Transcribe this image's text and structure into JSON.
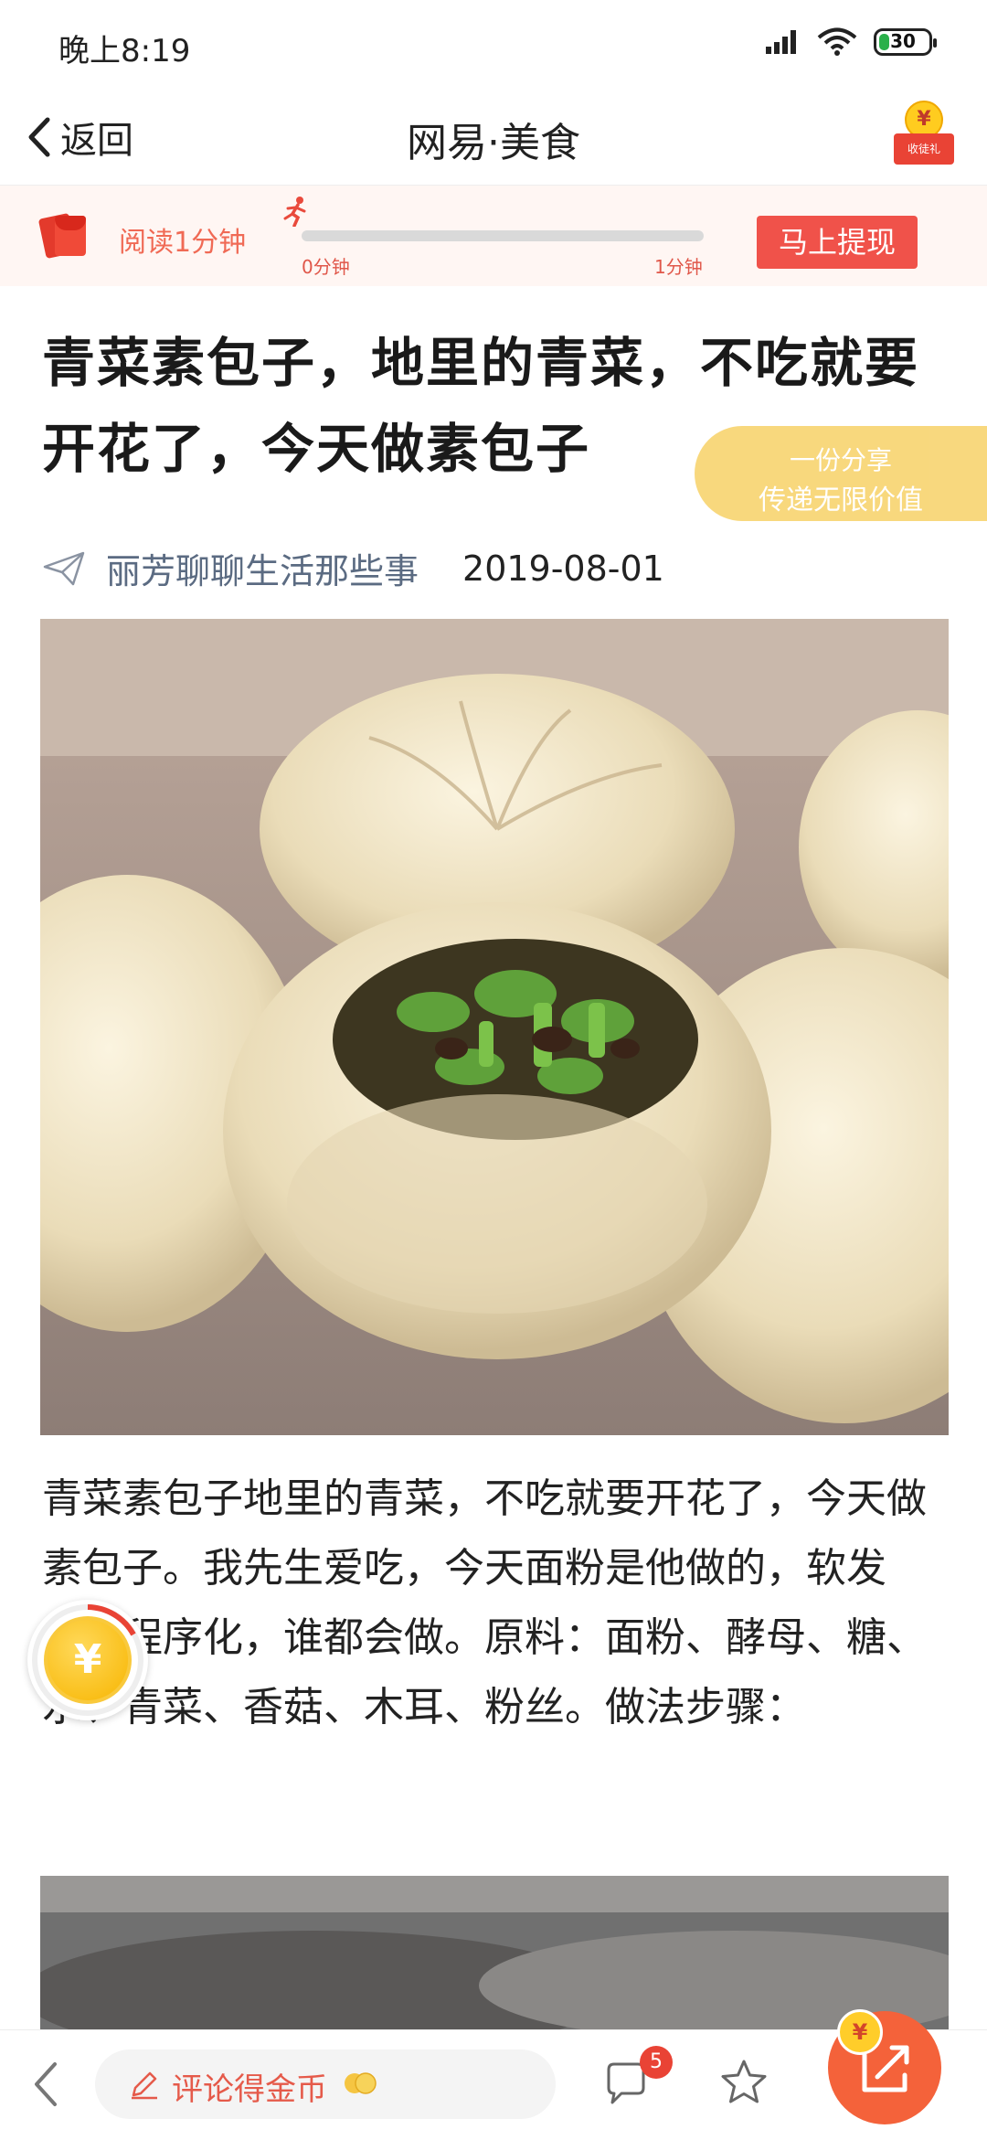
{
  "status_bar": {
    "time": "晚上8:19",
    "battery": "30",
    "battery_level": 0.3
  },
  "nav": {
    "back_label": "返回",
    "title": "网易·美食",
    "gift_symbol": "¥",
    "gift_label": "收徒礼"
  },
  "reading": {
    "label": "阅读1分钟",
    "start_label": "0分钟",
    "end_label": "1分钟",
    "progress": 0,
    "withdraw_label": "马上提现"
  },
  "article": {
    "title": "青菜素包子，地里的青菜，不吃就要开花了，今天做素包子",
    "author": "丽芳聊聊生活那些事",
    "date": "2019-08-01",
    "body": "青菜素包子地里的青菜，不吃就要开花了，今天做素包子。我先生爱吃，今天面粉是他做的，软发面，程序化，谁都会做。原料：面粉、酵母、糖、水、青菜、香菇、木耳、粉丝。做法步骤："
  },
  "share_badge": {
    "line1": "一份分享",
    "line2": "传递无限价值"
  },
  "coin_widget": {
    "symbol": "¥"
  },
  "bottom_bar": {
    "comment_label": "评论得金币",
    "comment_count": "5",
    "share_coin_symbol": "¥"
  },
  "colors": {
    "accent": "#e94335",
    "link": "#5b6b82",
    "share_badge": "#f8d677",
    "fab": "#f4623a"
  }
}
